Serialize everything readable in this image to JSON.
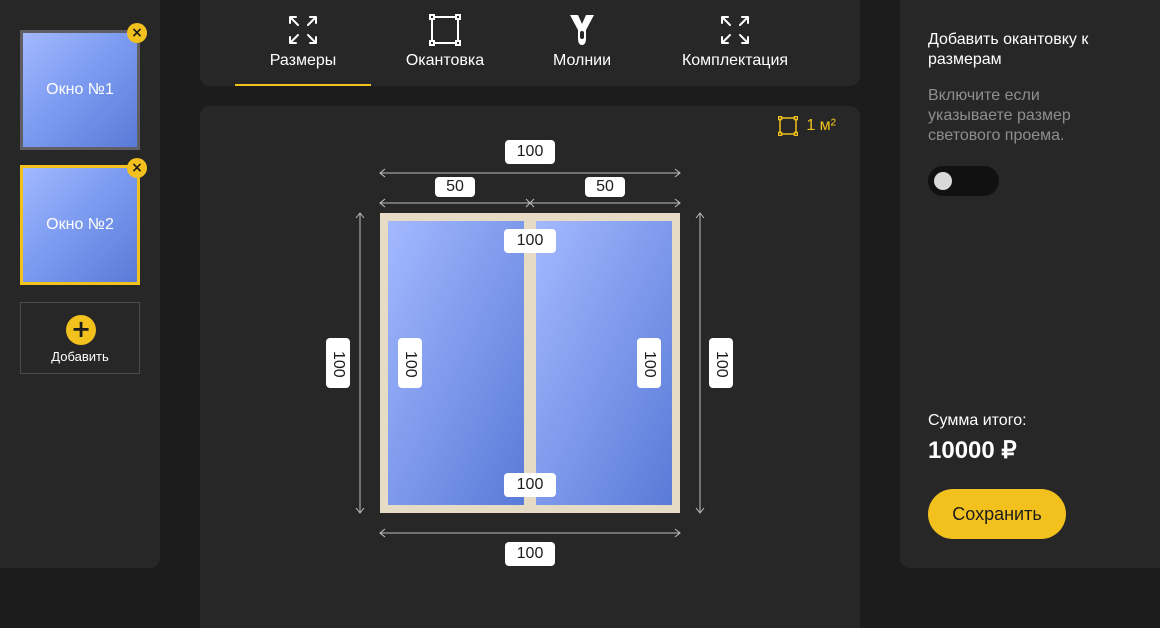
{
  "windows": [
    {
      "label": "Окно №1",
      "active": false
    },
    {
      "label": "Окно №2",
      "active": true
    }
  ],
  "add_label": "Добавить",
  "tabs": [
    {
      "label": "Размеры",
      "icon": "expand-icon",
      "active": true
    },
    {
      "label": "Окантовка",
      "icon": "frame-square-icon",
      "active": false
    },
    {
      "label": "Молнии",
      "icon": "zipper-icon",
      "active": false
    },
    {
      "label": "Комплектация",
      "icon": "expand-icon",
      "active": false
    }
  ],
  "area": "1 м²",
  "dimensions": {
    "top_total": "100",
    "top_left": "50",
    "top_right": "50",
    "inner_top": "100",
    "inner_bottom": "100",
    "bottom_total": "100",
    "left_outer": "100",
    "left_inner": "100",
    "right_inner": "100",
    "right_outer": "100"
  },
  "right_panel": {
    "title": "Добавить окантовку к размерам",
    "description": "Включите если указываете размер светового проема.",
    "toggle_on": false,
    "total_label": "Сумма итого:",
    "total_value": "10000 ₽",
    "save_label": "Сохранить"
  },
  "colors": {
    "accent": "#f2c11d",
    "panel": "#272727",
    "background": "#1c1c1c",
    "frame": "#e6dcc5",
    "glass_light": "#a3b9ff",
    "glass_dark": "#5a7ad8"
  }
}
